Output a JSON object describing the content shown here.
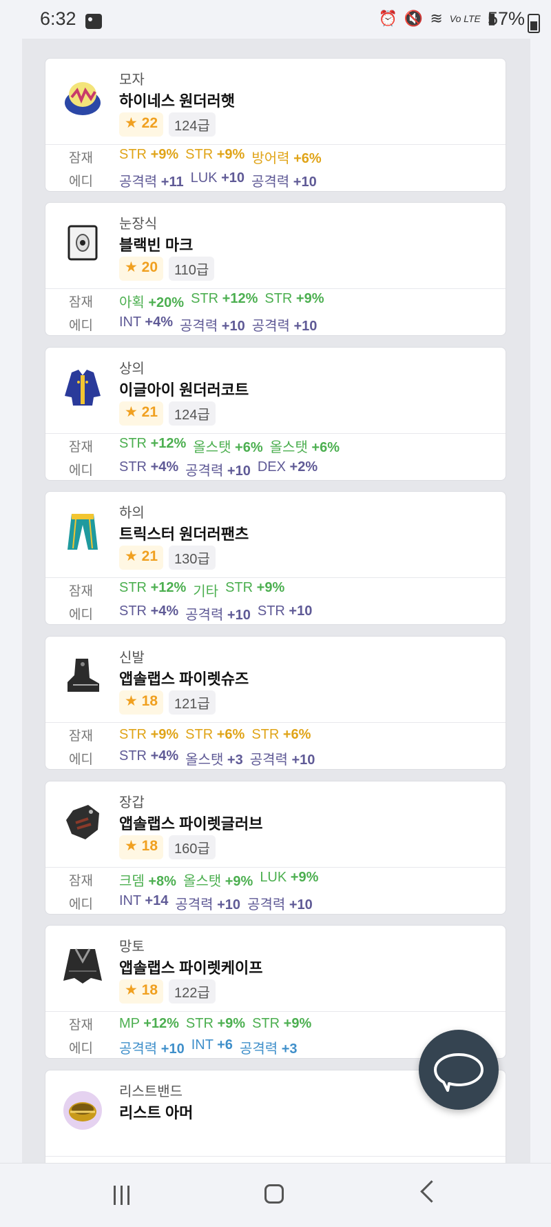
{
  "status_bar": {
    "time": "6:32",
    "battery": "57%",
    "network": "Vo LTE"
  },
  "colors": {
    "gold": "#e0a418",
    "green": "#4caf50",
    "purple": "#5f5a96",
    "blue": "#3f8fca",
    "fab": "#354451"
  },
  "labels": {
    "potential": "잠재",
    "additional": "에디"
  },
  "items": [
    {
      "slot": "모자",
      "name": "하이네스 원더러햇",
      "stars": "★ 22",
      "level": "124급",
      "icon": "hat-icon",
      "potential": [
        {
          "name": "STR",
          "value": "+9%",
          "color": "gold"
        },
        {
          "name": "STR",
          "value": "+9%",
          "color": "gold"
        },
        {
          "name": "방어력",
          "value": "+6%",
          "color": "gold"
        }
      ],
      "additional": [
        {
          "name": "공격력",
          "value": "+11",
          "color": "purple"
        },
        {
          "name": "LUK",
          "value": "+10",
          "color": "purple"
        },
        {
          "name": "공격력",
          "value": "+10",
          "color": "purple"
        }
      ]
    },
    {
      "slot": "눈장식",
      "name": "블랙빈 마크",
      "stars": "★ 20",
      "level": "110급",
      "icon": "eye-accessory-icon",
      "potential": [
        {
          "name": "아획",
          "value": "+20%",
          "color": "green"
        },
        {
          "name": "STR",
          "value": "+12%",
          "color": "green"
        },
        {
          "name": "STR",
          "value": "+9%",
          "color": "green"
        }
      ],
      "additional": [
        {
          "name": "INT",
          "value": "+4%",
          "color": "purple"
        },
        {
          "name": "공격력",
          "value": "+10",
          "color": "purple"
        },
        {
          "name": "공격력",
          "value": "+10",
          "color": "purple"
        }
      ]
    },
    {
      "slot": "상의",
      "name": "이글아이 원더러코트",
      "stars": "★ 21",
      "level": "124급",
      "icon": "coat-icon",
      "potential": [
        {
          "name": "STR",
          "value": "+12%",
          "color": "green"
        },
        {
          "name": "올스탯",
          "value": "+6%",
          "color": "green"
        },
        {
          "name": "올스탯",
          "value": "+6%",
          "color": "green"
        }
      ],
      "additional": [
        {
          "name": "STR",
          "value": "+4%",
          "color": "purple"
        },
        {
          "name": "공격력",
          "value": "+10",
          "color": "purple"
        },
        {
          "name": "DEX",
          "value": "+2%",
          "color": "purple"
        }
      ]
    },
    {
      "slot": "하의",
      "name": "트릭스터 원더러팬츠",
      "stars": "★ 21",
      "level": "130급",
      "icon": "pants-icon",
      "potential": [
        {
          "name": "STR",
          "value": "+12%",
          "color": "green"
        },
        {
          "name": "기타",
          "value": "",
          "color": "green"
        },
        {
          "name": "STR",
          "value": "+9%",
          "color": "green"
        }
      ],
      "additional": [
        {
          "name": "STR",
          "value": "+4%",
          "color": "purple"
        },
        {
          "name": "공격력",
          "value": "+10",
          "color": "purple"
        },
        {
          "name": "STR",
          "value": "+10",
          "color": "purple"
        }
      ]
    },
    {
      "slot": "신발",
      "name": "앱솔랩스 파이렛슈즈",
      "stars": "★ 18",
      "level": "121급",
      "icon": "shoes-icon",
      "potential": [
        {
          "name": "STR",
          "value": "+9%",
          "color": "gold"
        },
        {
          "name": "STR",
          "value": "+6%",
          "color": "gold"
        },
        {
          "name": "STR",
          "value": "+6%",
          "color": "gold"
        }
      ],
      "additional": [
        {
          "name": "STR",
          "value": "+4%",
          "color": "purple"
        },
        {
          "name": "올스탯",
          "value": "+3",
          "color": "purple"
        },
        {
          "name": "공격력",
          "value": "+10",
          "color": "purple"
        }
      ]
    },
    {
      "slot": "장갑",
      "name": "앱솔랩스 파이렛글러브",
      "stars": "★ 18",
      "level": "160급",
      "icon": "gloves-icon",
      "potential": [
        {
          "name": "크뎀",
          "value": "+8%",
          "color": "green"
        },
        {
          "name": "올스탯",
          "value": "+9%",
          "color": "green"
        },
        {
          "name": "LUK",
          "value": "+9%",
          "color": "green"
        }
      ],
      "additional": [
        {
          "name": "INT",
          "value": "+14",
          "color": "purple"
        },
        {
          "name": "공격력",
          "value": "+10",
          "color": "purple"
        },
        {
          "name": "공격력",
          "value": "+10",
          "color": "purple"
        }
      ]
    },
    {
      "slot": "망토",
      "name": "앱솔랩스 파이렛케이프",
      "stars": "★ 18",
      "level": "122급",
      "icon": "cape-icon",
      "potential": [
        {
          "name": "MP",
          "value": "+12%",
          "color": "green"
        },
        {
          "name": "STR",
          "value": "+9%",
          "color": "green"
        },
        {
          "name": "STR",
          "value": "+9%",
          "color": "green"
        }
      ],
      "additional": [
        {
          "name": "공격력",
          "value": "+10",
          "color": "blue"
        },
        {
          "name": "INT",
          "value": "+6",
          "color": "blue"
        },
        {
          "name": "공격력",
          "value": "+3",
          "color": "blue"
        }
      ]
    },
    {
      "slot": "리스트밴드",
      "name": "리스트 아머",
      "stars": "",
      "level": "",
      "icon": "wristband-icon",
      "potential": [],
      "additional": []
    }
  ]
}
